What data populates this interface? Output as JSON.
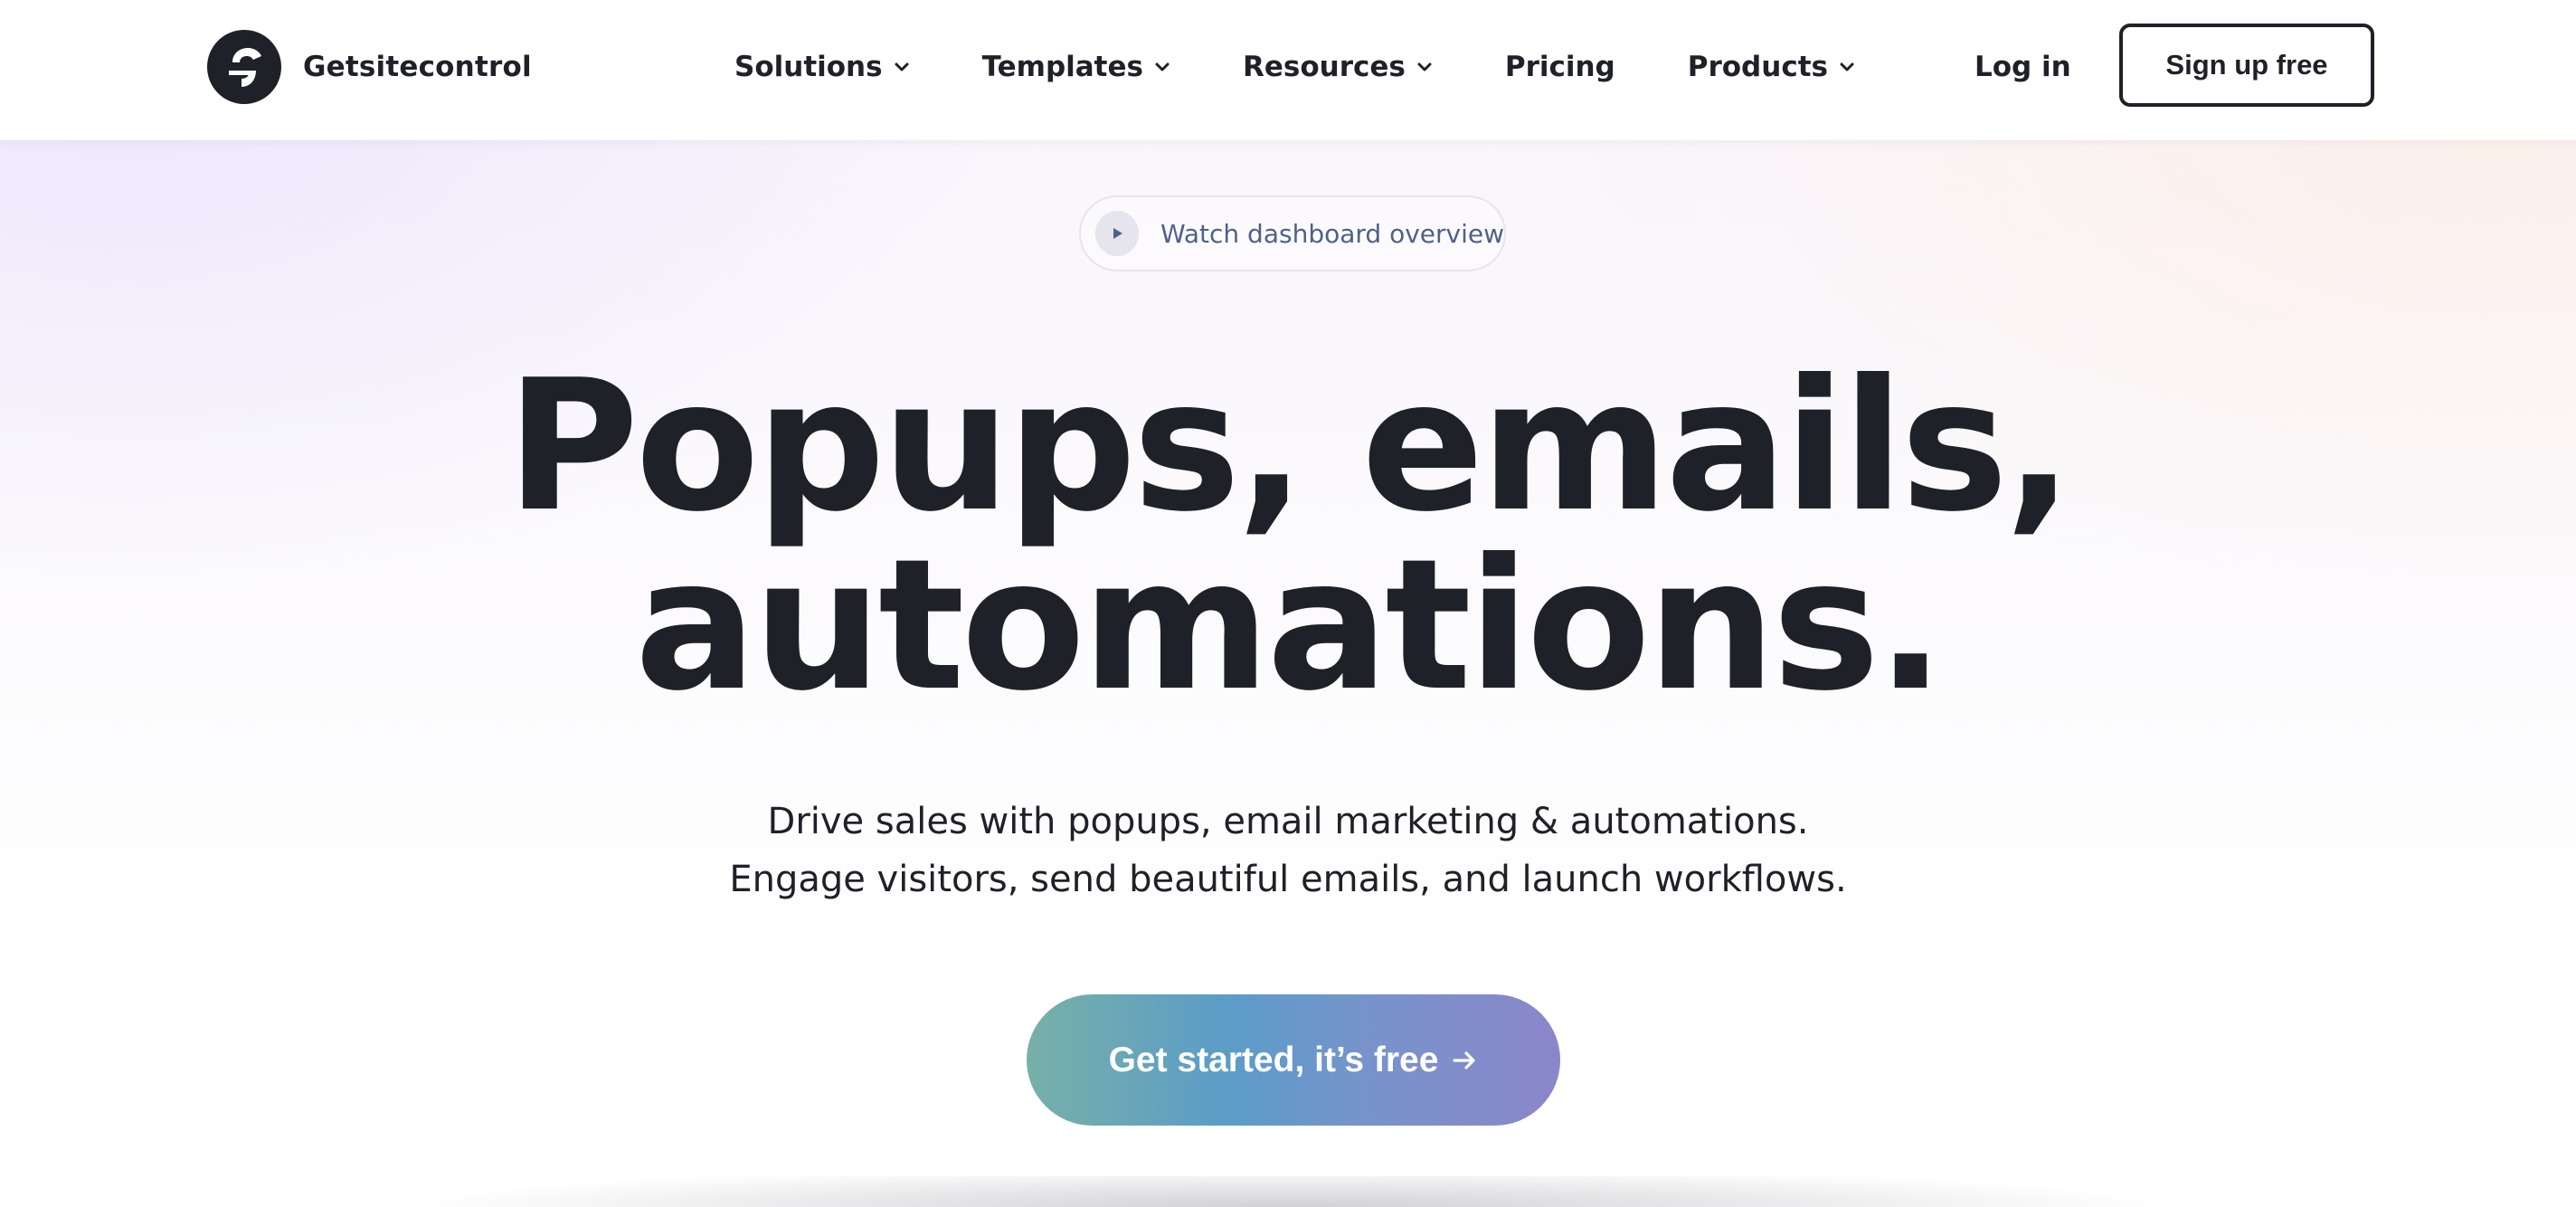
{
  "header": {
    "brand_name": "Getsitecontrol",
    "nav": [
      {
        "label": "Solutions",
        "has_dropdown": true
      },
      {
        "label": "Templates",
        "has_dropdown": true
      },
      {
        "label": "Resources",
        "has_dropdown": true
      },
      {
        "label": "Pricing",
        "has_dropdown": false
      },
      {
        "label": "Products",
        "has_dropdown": true
      }
    ],
    "login_label": "Log in",
    "signup_label": "Sign up free"
  },
  "hero": {
    "watch_label": "Watch dashboard overview",
    "headline_line1": "Popups, emails,",
    "headline_line2": "automations.",
    "sub_line1": "Drive sales with popups, email marketing & automations.",
    "sub_line2": "Engage visitors, send beautiful emails, and launch workflows.",
    "cta_label": "Get started, it’s free"
  },
  "icons": {
    "logo": "getsitecontrol-logo-icon",
    "dropdown": "chevron-down-icon",
    "play": "play-icon",
    "cta_arrow": "arrow-right-icon"
  },
  "colors": {
    "text": "#1f2128",
    "watch_text": "#4e6288",
    "cta_gradient_start": "#77b0a8",
    "cta_gradient_end": "#8b86ca"
  }
}
